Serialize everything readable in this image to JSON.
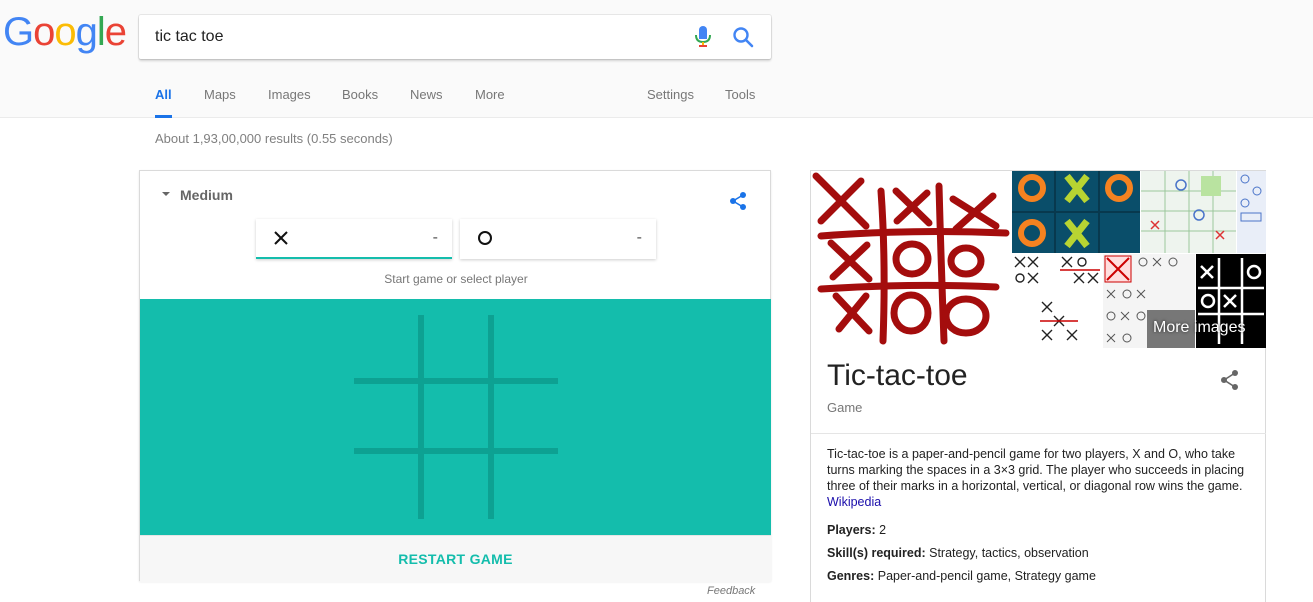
{
  "search": {
    "query": "tic tac toe",
    "logo_letters": [
      {
        "ch": "G",
        "color": "#4285F4"
      },
      {
        "ch": "o",
        "color": "#EA4335"
      },
      {
        "ch": "o",
        "color": "#FBBC05"
      },
      {
        "ch": "g",
        "color": "#4285F4"
      },
      {
        "ch": "l",
        "color": "#34A853"
      },
      {
        "ch": "e",
        "color": "#EA4335"
      }
    ]
  },
  "tabs": {
    "all": "All",
    "maps": "Maps",
    "images": "Images",
    "books": "Books",
    "news": "News",
    "more": "More",
    "settings": "Settings",
    "tools": "Tools"
  },
  "results_stats": "About 1,93,00,000 results (0.55 seconds)",
  "game": {
    "difficulty": "Medium",
    "player_x_score": "-",
    "player_o_score": "-",
    "status": "Start game or select player",
    "restart_label": "RESTART GAME",
    "board_color": "#14bdac",
    "grid_color": "#0da192"
  },
  "feedback": "Feedback",
  "knowledge_panel": {
    "more_images": "More images",
    "title": "Tic-tac-toe",
    "subtitle": "Game",
    "description": "Tic-tac-toe is a paper-and-pencil game for two players, X and O, who take turns marking the spaces in a 3×3 grid. The player who succeeds in placing three of their marks in a horizontal, vertical, or diagonal row wins the game.",
    "source_link": "Wikipedia",
    "facts": [
      {
        "label": "Players:",
        "value": "2"
      },
      {
        "label": "Skill(s) required:",
        "value": "Strategy, tactics, observation"
      },
      {
        "label": "Genres:",
        "value": "Paper-and-pencil game, Strategy game"
      }
    ]
  }
}
